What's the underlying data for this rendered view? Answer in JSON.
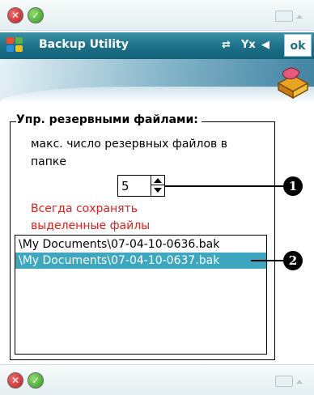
{
  "topbar": {
    "close_icon": "✕",
    "confirm_icon": "✓"
  },
  "titlebar": {
    "title": "Backup Utility",
    "connectivity_icon": "⇄",
    "signal_icon": "Yx",
    "volume_icon": "◀",
    "ok_label": "ok"
  },
  "group": {
    "title": "Упр. резервными файлами:",
    "max_files_label": "макс. число резервных файлов в папке",
    "max_files_value": "5",
    "always_keep_link": "Всегда сохранять выделенные файлы"
  },
  "files": [
    {
      "name": "\\My Documents\\07-04-10-0636.bak",
      "selected": false
    },
    {
      "name": "\\My Documents\\07-04-10-0637.bak",
      "selected": true
    }
  ],
  "callouts": [
    "1",
    "2"
  ],
  "bottombar": {
    "close_icon": "✕",
    "confirm_icon": "✓"
  },
  "colors": {
    "titlebar": "#1b6f87",
    "selection": "#3da7bf",
    "link": "#e0201c"
  }
}
